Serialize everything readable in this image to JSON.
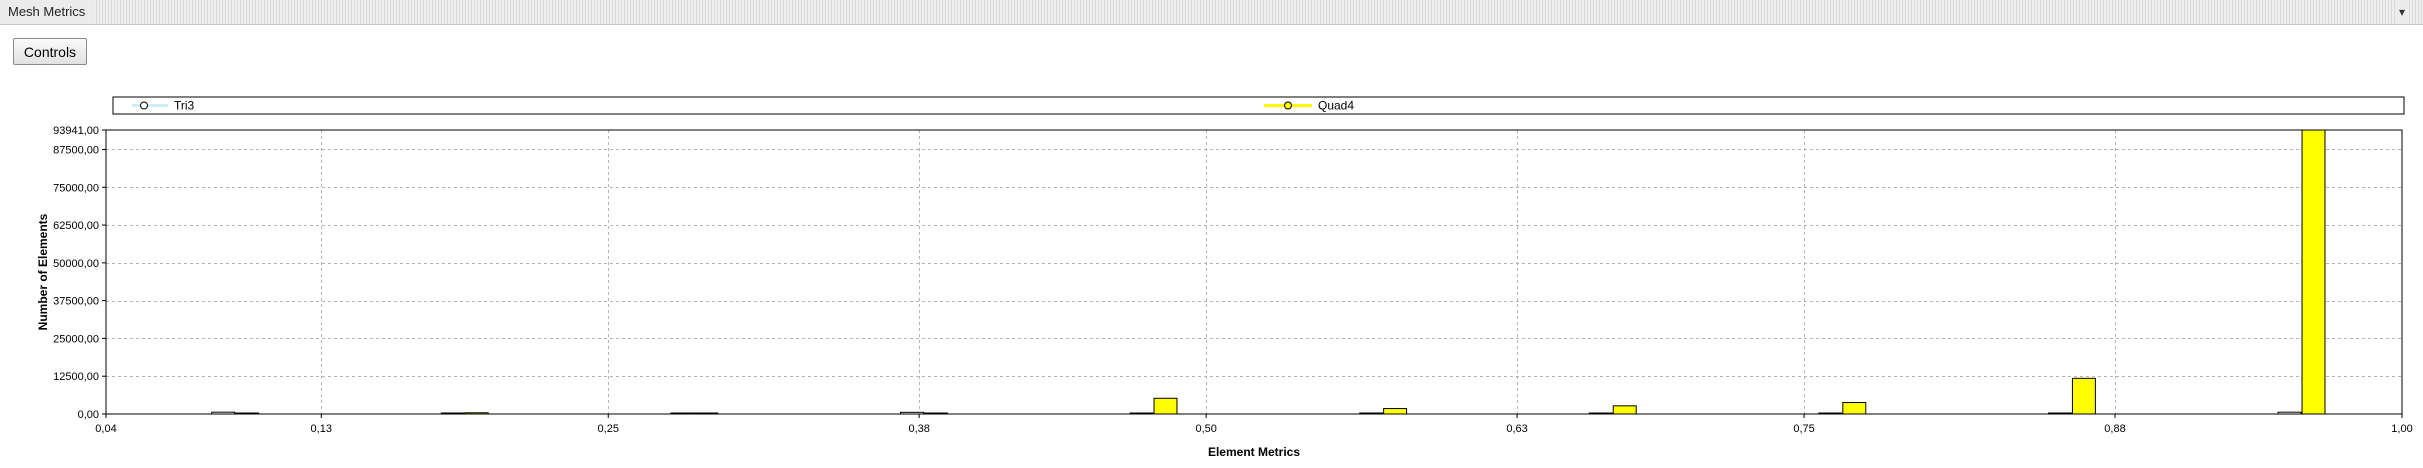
{
  "panel": {
    "title": "Mesh Metrics",
    "collapse_icon": "chevron-down-icon",
    "controls_label": "Controls"
  },
  "chart_data": {
    "type": "bar",
    "title": "",
    "xlabel": "Element Metrics",
    "ylabel": "Number of Elements",
    "xlim": [
      0.04,
      1.0
    ],
    "ylim": [
      0,
      93941
    ],
    "grid": true,
    "legend_position": "top",
    "x_ticks": [
      "0,04",
      "0,13",
      "0,25",
      "0,38",
      "0,50",
      "0,63",
      "0,75",
      "0,88",
      "1,00"
    ],
    "y_ticks": [
      "0,00",
      "12500,00",
      "25000,00",
      "37500,00",
      "50000,00",
      "62500,00",
      "75000,00",
      "87500,00",
      "93941,00"
    ],
    "bin_width": 0.0096,
    "series": [
      {
        "name": "Tri3",
        "color": "#ffffff",
        "edge_color": "#000000",
        "x": [
          0.089,
          0.185,
          0.281,
          0.377,
          0.473,
          0.569,
          0.665,
          0.761,
          0.857,
          0.953
        ],
        "values": [
          600,
          80,
          250,
          550,
          250,
          100,
          150,
          80,
          250,
          600
        ]
      },
      {
        "name": "Quad4",
        "color": "#ffff00",
        "edge_color": "#000000",
        "x": [
          0.099,
          0.195,
          0.291,
          0.387,
          0.483,
          0.579,
          0.675,
          0.771,
          0.867,
          0.963
        ],
        "values": [
          100,
          400,
          50,
          50,
          5200,
          1800,
          2700,
          3800,
          11800,
          93941
        ]
      }
    ]
  }
}
